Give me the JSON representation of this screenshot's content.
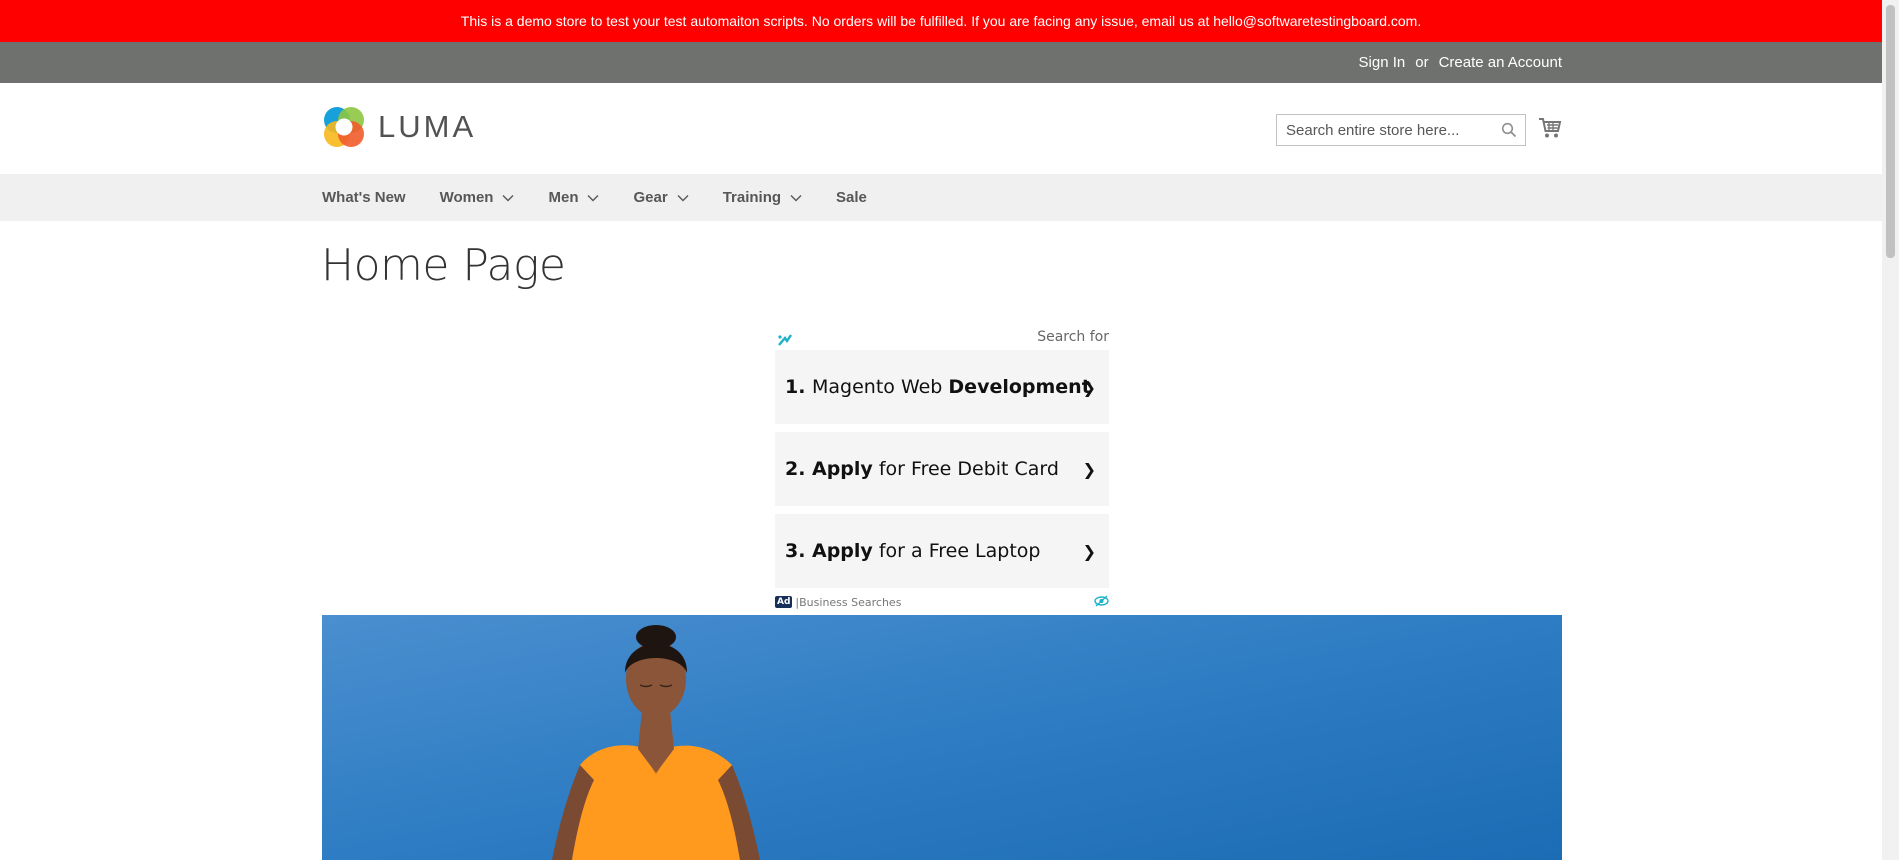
{
  "demo_notice": "This is a demo store to test your test automaiton scripts. No orders will be fulfilled. If you are facing any issue, email us at hello@softwaretestingboard.com.",
  "panel": {
    "sign_in": "Sign In",
    "or": "or",
    "create_account": "Create an Account"
  },
  "header": {
    "logo_text": "LUMA",
    "search_placeholder": "Search entire store here...",
    "search_value": ""
  },
  "nav": {
    "items": [
      {
        "label": "What's New",
        "has_submenu": false
      },
      {
        "label": "Women",
        "has_submenu": true
      },
      {
        "label": "Men",
        "has_submenu": true
      },
      {
        "label": "Gear",
        "has_submenu": true
      },
      {
        "label": "Training",
        "has_submenu": true
      },
      {
        "label": "Sale",
        "has_submenu": false
      }
    ]
  },
  "page_title": "Home Page",
  "ad": {
    "search_for": "Search for",
    "results": [
      {
        "num": "1.",
        "pre": "Magento Web ",
        "bold": "Development",
        "post": ""
      },
      {
        "num": "2.",
        "pre": "",
        "bold": "Apply",
        "post": " for Free Debit Card"
      },
      {
        "num": "3.",
        "pre": "",
        "bold": "Apply",
        "post": " for a Free Laptop"
      }
    ],
    "badge": "Ad",
    "footer_text": "Business Searches",
    "arrow": "❯"
  },
  "colors": {
    "banner": "#ff0000",
    "panel": "#6e716e",
    "nav": "#f0f0f0",
    "hero_sky": "#2b7bc4",
    "shirt": "#ff9a1f"
  },
  "icons": {
    "search": "search-icon",
    "cart": "cart-icon",
    "chevron": "chevron-down-icon",
    "ad_choices": "adchoices-icon"
  }
}
